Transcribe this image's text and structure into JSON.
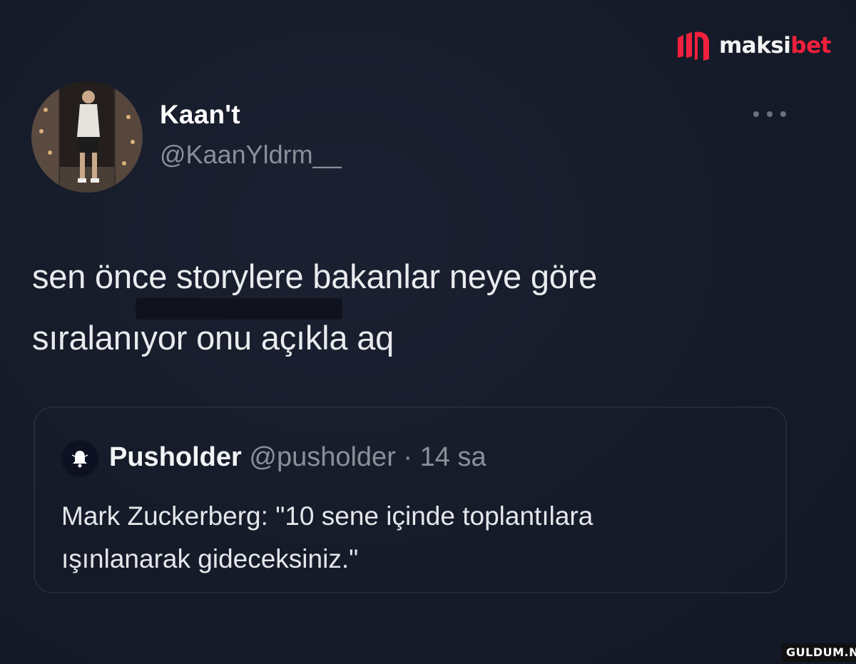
{
  "brand": {
    "name_part_1": "maksi",
    "name_part_2": "bet",
    "accent_color": "#f2203d",
    "logo_icon": "maksibet-logo-icon"
  },
  "tweet": {
    "author": {
      "display_name": "Kaan't",
      "handle": "@KaanYldrm__",
      "avatar_icon": "user-avatar-photo"
    },
    "more_icon": "more-options-icon",
    "text_line_1": "sen önce storylere bakanlar neye göre",
    "text_line_2": "sıralanıyor onu açıkla aq"
  },
  "quoted_tweet": {
    "avatar_icon": "bell-icon",
    "display_name": "Pusholder",
    "handle": "@pusholder",
    "separator": " · ",
    "time": "14 sa",
    "text_line_1": "Mark Zuckerberg: \"10 sene içinde toplantılara",
    "text_line_2": "ışınlanarak gideceksiniz.\""
  },
  "watermark": {
    "site": "GULDUM.NET"
  }
}
